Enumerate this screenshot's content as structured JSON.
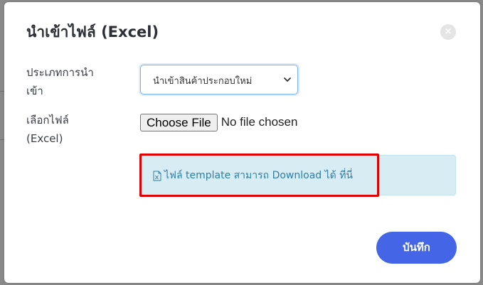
{
  "modal": {
    "title": "นำเข้าไฟล์ (Excel)",
    "close_glyph": "×"
  },
  "form": {
    "import_type_label": "ประเภทการนำ\nเข้า",
    "import_type_value": "นำเข้าสินค้าประกอบใหม่",
    "file_label": "เลือกไฟล์\n(Excel)",
    "choose_file_label": "Choose File",
    "no_file_text": "No file chosen"
  },
  "info": {
    "template_link_text": "ไฟล์ template สามารถ Download ได้ ที่นี่",
    "icon": "excel-file-icon"
  },
  "footer": {
    "save_label": "บันทึก"
  },
  "colors": {
    "primary": "#4466e6",
    "info_bg": "#d7ecf3",
    "link": "#2e7fa8",
    "highlight": "#e00000"
  }
}
